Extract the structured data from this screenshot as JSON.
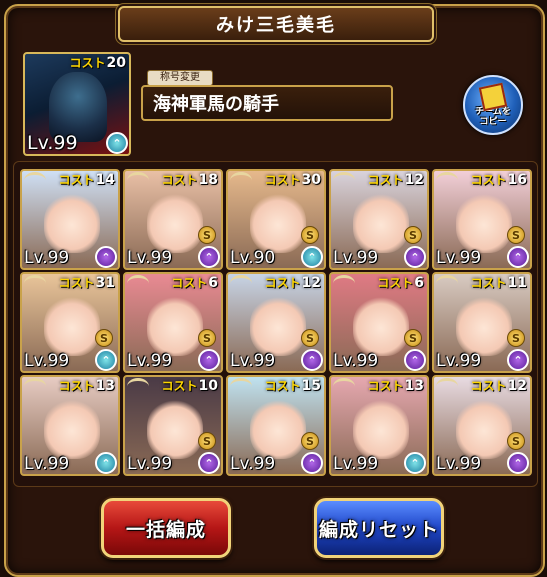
{
  "window": {
    "title": "みけ三毛美毛"
  },
  "leader": {
    "cost_label": "コスト",
    "cost": "20",
    "level": "Lv.99",
    "rank": "teal"
  },
  "nickname": {
    "tag": "称号変更",
    "value": "海神軍馬の騎手"
  },
  "copy_button": {
    "label": "チームを\nコピー"
  },
  "units": [
    {
      "cost_label": "コスト",
      "cost": "14",
      "level": "Lv.99",
      "rank": "purple",
      "s": false,
      "bg": "#cfe0f5"
    },
    {
      "cost_label": "コスト",
      "cost": "18",
      "level": "Lv.99",
      "rank": "purple",
      "s": true,
      "bg": "#e9c0a6"
    },
    {
      "cost_label": "コスト",
      "cost": "30",
      "level": "Lv.90",
      "rank": "teal",
      "s": true,
      "bg": "#e6b98c"
    },
    {
      "cost_label": "コスト",
      "cost": "12",
      "level": "Lv.99",
      "rank": "purple",
      "s": true,
      "bg": "#d9d3dc"
    },
    {
      "cost_label": "コスト",
      "cost": "16",
      "level": "Lv.99",
      "rank": "purple",
      "s": true,
      "bg": "#f2cfd8"
    },
    {
      "cost_label": "コスト",
      "cost": "31",
      "level": "Lv.99",
      "rank": "teal",
      "s": true,
      "bg": "#e9c59a"
    },
    {
      "cost_label": "コスト",
      "cost": "6",
      "level": "Lv.99",
      "rank": "purple",
      "s": true,
      "bg": "#e98a93"
    },
    {
      "cost_label": "コスト",
      "cost": "12",
      "level": "Lv.99",
      "rank": "purple",
      "s": true,
      "bg": "#c7d4e6"
    },
    {
      "cost_label": "コスト",
      "cost": "6",
      "level": "Lv.99",
      "rank": "purple",
      "s": true,
      "bg": "#e07a84"
    },
    {
      "cost_label": "コスト",
      "cost": "11",
      "level": "Lv.99",
      "rank": "purple",
      "s": true,
      "bg": "#d8cbc2"
    },
    {
      "cost_label": "コスト",
      "cost": "13",
      "level": "Lv.99",
      "rank": "teal",
      "s": false,
      "bg": "#e7ccc3"
    },
    {
      "cost_label": "コスト",
      "cost": "10",
      "level": "Lv.99",
      "rank": "purple",
      "s": true,
      "bg": "#4a3a46"
    },
    {
      "cost_label": "コスト",
      "cost": "15",
      "level": "Lv.99",
      "rank": "purple",
      "s": true,
      "bg": "#bfe2f0"
    },
    {
      "cost_label": "コスト",
      "cost": "13",
      "level": "Lv.99",
      "rank": "teal",
      "s": false,
      "bg": "#e6a8b0"
    },
    {
      "cost_label": "コスト",
      "cost": "12",
      "level": "Lv.99",
      "rank": "purple",
      "s": true,
      "bg": "#e8dbe2"
    }
  ],
  "buttons": {
    "bulk": "一括編成",
    "reset": "編成リセット"
  },
  "colors": {
    "frame_gold": "#c9a24a",
    "panel_bg": "#2a140b",
    "red_button": "#b51616",
    "blue_button": "#1f46c8"
  }
}
